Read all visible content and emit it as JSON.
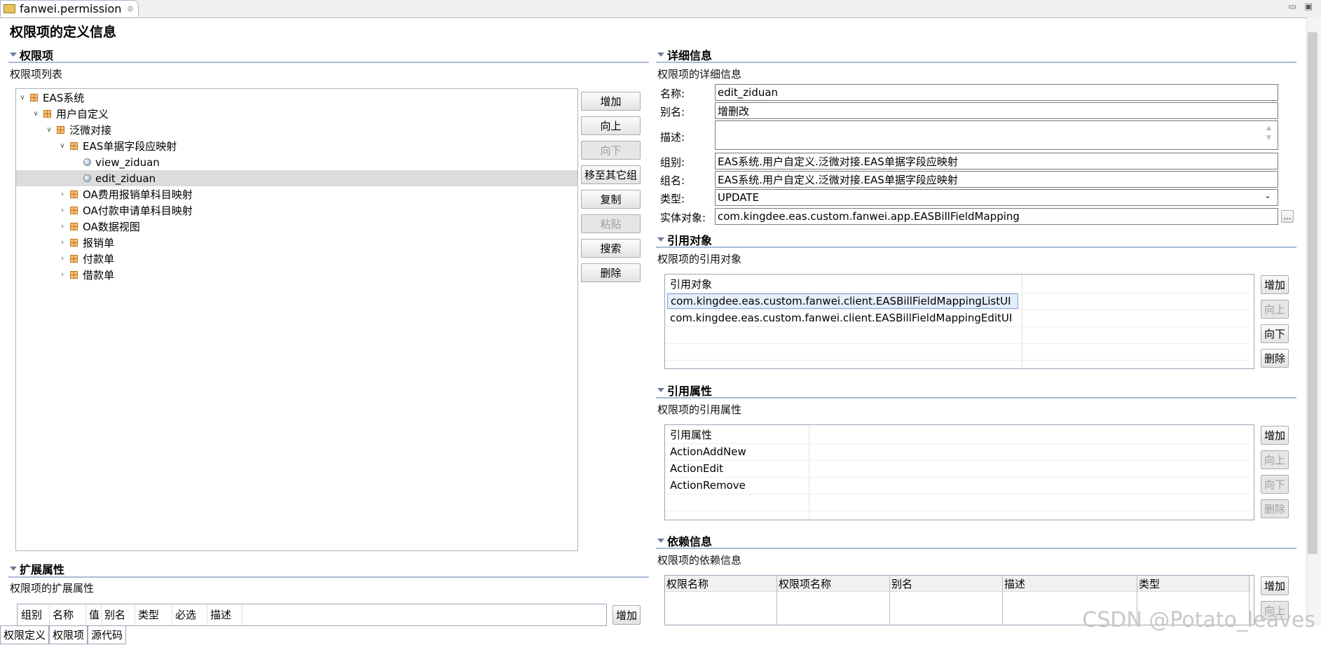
{
  "editor": {
    "tab_title": "fanwei.permission",
    "tab_close": "⊘"
  },
  "page_title": "权限项的定义信息",
  "left": {
    "section_title": "权限项",
    "subtitle": "权限项列表",
    "tree": [
      {
        "label": "EAS系统",
        "level": 0,
        "expanded": true,
        "kind": "pkg"
      },
      {
        "label": "用户自定义",
        "level": 1,
        "expanded": true,
        "kind": "pkg"
      },
      {
        "label": "泛微对接",
        "level": 2,
        "expanded": true,
        "kind": "pkg"
      },
      {
        "label": "EAS单据字段应映射",
        "level": 3,
        "expanded": true,
        "kind": "pkg"
      },
      {
        "label": "view_ziduan",
        "level": 4,
        "kind": "leaf"
      },
      {
        "label": "edit_ziduan",
        "level": 4,
        "kind": "leaf",
        "selected": true
      },
      {
        "label": "OA费用报销单科目映射",
        "level": 3,
        "expanded": false,
        "kind": "pkg"
      },
      {
        "label": "OA付款申请单科目映射",
        "level": 3,
        "expanded": false,
        "kind": "pkg"
      },
      {
        "label": "OA数据视图",
        "level": 3,
        "expanded": false,
        "kind": "pkg"
      },
      {
        "label": "报销单",
        "level": 3,
        "expanded": false,
        "kind": "pkg"
      },
      {
        "label": "付款单",
        "level": 3,
        "expanded": false,
        "kind": "pkg"
      },
      {
        "label": "借款单",
        "level": 3,
        "expanded": false,
        "kind": "pkg"
      }
    ],
    "buttons": [
      {
        "label": "增加",
        "enabled": true
      },
      {
        "label": "向上",
        "enabled": true
      },
      {
        "label": "向下",
        "enabled": false
      },
      {
        "label": "移至其它组",
        "enabled": true
      },
      {
        "label": "复制",
        "enabled": true
      },
      {
        "label": "粘贴",
        "enabled": false
      },
      {
        "label": "搜索",
        "enabled": true
      },
      {
        "label": "删除",
        "enabled": true
      }
    ]
  },
  "ext": {
    "section_title": "扩展属性",
    "subtitle": "权限项的扩展属性",
    "columns": [
      "组别",
      "名称",
      "值",
      "别名",
      "类型",
      "必选",
      "描述"
    ],
    "add_button": "增加"
  },
  "detail": {
    "section_title": "详细信息",
    "subtitle": "权限项的详细信息",
    "fields": {
      "name_label": "名称:",
      "name_value": "edit_ziduan",
      "alias_label": "别名:",
      "alias_value": "增删改",
      "desc_label": "描述:",
      "desc_value": "",
      "group_label": "组别:",
      "group_value": "EAS系统.用户自定义.泛微对接.EAS单据字段应映射",
      "groupname_label": "组名:",
      "groupname_value": "EAS系统.用户自定义.泛微对接.EAS单据字段应映射",
      "type_label": "类型:",
      "type_value": "UPDATE",
      "entity_label": "实体对象:",
      "entity_value": "com.kingdee.eas.custom.fanwei.app.EASBillFieldMapping",
      "browse_label": "..."
    }
  },
  "ref_objects": {
    "section_title": "引用对象",
    "subtitle": "权限项的引用对象",
    "header": "引用对象",
    "rows": [
      "com.kingdee.eas.custom.fanwei.client.EASBillFieldMappingListUI",
      "com.kingdee.eas.custom.fanwei.client.EASBillFieldMappingEditUI"
    ],
    "buttons": [
      {
        "label": "增加",
        "enabled": true
      },
      {
        "label": "向上",
        "enabled": false
      },
      {
        "label": "向下",
        "enabled": true
      },
      {
        "label": "删除",
        "enabled": true
      }
    ]
  },
  "ref_props": {
    "section_title": "引用属性",
    "subtitle": "权限项的引用属性",
    "header": "引用属性",
    "rows": [
      "ActionAddNew",
      "ActionEdit",
      "ActionRemove"
    ],
    "buttons": [
      {
        "label": "增加",
        "enabled": true
      },
      {
        "label": "向上",
        "enabled": false
      },
      {
        "label": "向下",
        "enabled": false
      },
      {
        "label": "删除",
        "enabled": false
      }
    ]
  },
  "deps": {
    "section_title": "依赖信息",
    "subtitle": "权限项的依赖信息",
    "columns": [
      "权限名称",
      "权限项名称",
      "别名",
      "描述",
      "类型"
    ],
    "buttons": [
      {
        "label": "增加",
        "enabled": true
      },
      {
        "label": "向上",
        "enabled": false
      }
    ]
  },
  "bottom_tabs": [
    "权限定义",
    "权限项",
    "源代码"
  ],
  "watermark": "CSDN @Potato_leaves"
}
